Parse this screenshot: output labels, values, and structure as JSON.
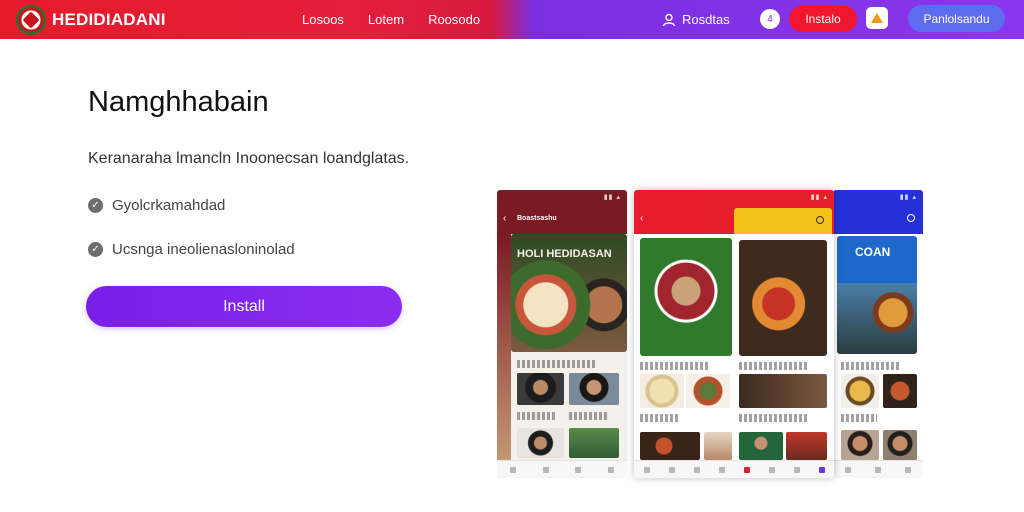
{
  "brand": {
    "name": "HEDIDIADANI"
  },
  "nav": {
    "links": [
      "Losoos",
      "Lotem",
      "Roosodo"
    ]
  },
  "header": {
    "user_label": "Rosdtas",
    "notification_count": "4",
    "install_label": "Instalo",
    "account_label": "Panlolsandu"
  },
  "hero": {
    "title": "Namghhabain",
    "subtitle": "Keranaraha lmancln Inoonecsan loandglatas.",
    "features": [
      "Gyolcrkamahdad",
      "Ucsnga ineolienasloninolad"
    ],
    "install_button": "Install"
  },
  "colors": {
    "red": "#e61a2b",
    "purple": "#7b2ee0",
    "install_purple": "#7a1ee8",
    "account_blue": "#5e6cf0"
  },
  "screens": {
    "left_title": "Boastsashu",
    "left_banner": "HOLI HEDIDASAN",
    "right_banner": "COAN"
  }
}
